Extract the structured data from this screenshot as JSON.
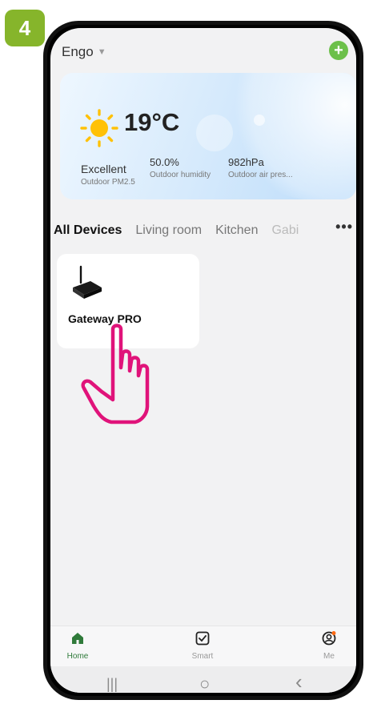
{
  "step_badge": "4",
  "header": {
    "home_name": "Engo",
    "add_icon": "plus-circle-icon",
    "accent": "#6cc04a"
  },
  "weather": {
    "temperature": "19°C",
    "icon": "sun-icon",
    "stats": [
      {
        "value": "Excellent",
        "label": "Outdoor PM2.5"
      },
      {
        "value": "50.0%",
        "label": "Outdoor humidity"
      },
      {
        "value": "982hPa",
        "label": "Outdoor air pres..."
      }
    ]
  },
  "tabs": [
    {
      "label": "All Devices",
      "active": true
    },
    {
      "label": "Living room",
      "active": false
    },
    {
      "label": "Kitchen",
      "active": false
    },
    {
      "label": "Gabi",
      "active": false
    }
  ],
  "more_label": "•••",
  "devices": [
    {
      "name": "Gateway PRO",
      "icon": "gateway-router-icon"
    }
  ],
  "bottom_nav": [
    {
      "label": "Home",
      "icon": "home-icon",
      "active": true
    },
    {
      "label": "Smart",
      "icon": "checkbox-icon",
      "active": false
    },
    {
      "label": "Me",
      "icon": "profile-icon",
      "active": false
    }
  ],
  "system_nav": {
    "recents": "|||",
    "home": "○",
    "back": "‹"
  },
  "colors": {
    "home_active": "#2f7a3a",
    "badge": "#86b52b",
    "pointer": "#e0137a"
  }
}
